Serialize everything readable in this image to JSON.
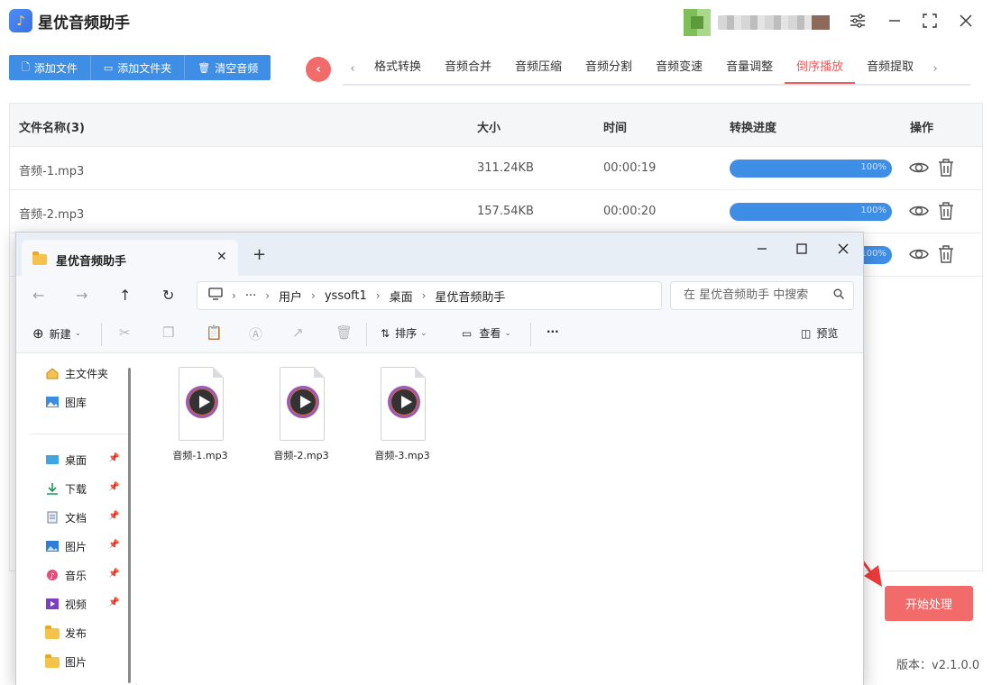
{
  "app": {
    "title": "星优音频助手",
    "version": "版本：v2.1.0.0",
    "accent": "#3f8ee6",
    "highlight": "#f26b6b"
  },
  "toolbar": {
    "add_file": "添加文件",
    "add_folder": "添加文件夹",
    "clear_audio": "清空音频"
  },
  "tabs": [
    "格式转换",
    "音频合并",
    "音频压缩",
    "音频分割",
    "音频变速",
    "音量调整",
    "倒序播放",
    "音频提取"
  ],
  "active_tab": "倒序播放",
  "table": {
    "headers": {
      "name": "文件名称(3)",
      "size": "大小",
      "time": "时间",
      "progress": "转换进度",
      "ops": "操作"
    },
    "rows": [
      {
        "name": "音频-1.mp3",
        "size": "311.24KB",
        "time": "00:00:19",
        "progress": "100%"
      },
      {
        "name": "音频-2.mp3",
        "size": "157.54KB",
        "time": "00:00:20",
        "progress": "100%"
      },
      {
        "progress": "100%"
      }
    ]
  },
  "start_button": "开始处理",
  "explorer": {
    "tab_title": "星优音频助手",
    "breadcrumb": [
      "用户",
      "yssoft1",
      "桌面",
      "星优音频助手"
    ],
    "search_placeholder": "在 星优音频助手 中搜索",
    "commands": {
      "new": "新建",
      "sort": "排序",
      "view": "查看",
      "more": "···",
      "preview": "预览"
    },
    "sidebar": {
      "top": [
        {
          "label": "主文件夹",
          "icon": "home-icon"
        },
        {
          "label": "图库",
          "icon": "gallery-icon"
        }
      ],
      "pinned": [
        {
          "label": "桌面",
          "icon": "desktop-icon"
        },
        {
          "label": "下载",
          "icon": "download-icon"
        },
        {
          "label": "文档",
          "icon": "document-icon"
        },
        {
          "label": "图片",
          "icon": "pictures-icon"
        },
        {
          "label": "音乐",
          "icon": "music-icon"
        },
        {
          "label": "视频",
          "icon": "video-icon"
        }
      ],
      "folders": [
        {
          "label": "发布"
        },
        {
          "label": "图片"
        }
      ]
    },
    "files": [
      "音频-1.mp3",
      "音频-2.mp3",
      "音频-3.mp3"
    ]
  }
}
